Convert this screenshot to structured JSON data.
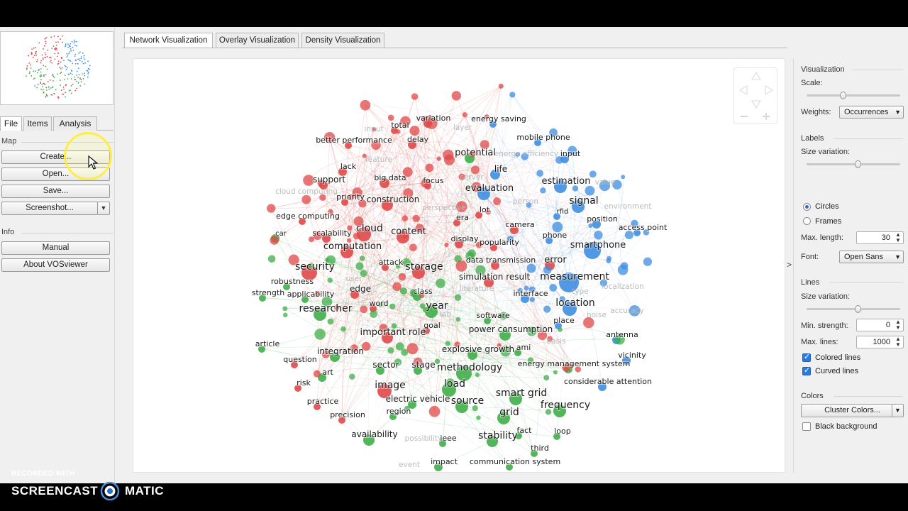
{
  "app": {
    "left_tabs": [
      "File",
      "Items",
      "Analysis"
    ],
    "main_tabs": [
      "Network Visualization",
      "Overlay Visualization",
      "Density Visualization"
    ]
  },
  "left_panel": {
    "map_label": "Map",
    "buttons": {
      "create": "Create...",
      "open": "Open...",
      "save": "Save...",
      "screenshot": "Screenshot..."
    },
    "info_label": "Info",
    "info_buttons": {
      "manual": "Manual",
      "about": "About VOSviewer"
    }
  },
  "right_panel": {
    "visualization_label": "Visualization",
    "scale_label": "Scale:",
    "scale_level": 0.38,
    "weights_label": "Weights:",
    "weights_value": "Occurrences",
    "labels_label": "Labels",
    "size_variation_label": "Size variation:",
    "label_size_variation_level": 0.55,
    "circles_label": "Circles",
    "frames_label": "Frames",
    "max_length_label": "Max. length:",
    "max_length_value": "30",
    "font_label": "Font:",
    "font_value": "Open Sans",
    "lines_label": "Lines",
    "lines_size_variation_label": "Size variation:",
    "line_size_variation_level": 0.55,
    "min_strength_label": "Min. strength:",
    "min_strength_value": "0",
    "max_lines_label": "Max. lines:",
    "max_lines_value": "1000",
    "colored_lines_label": "Colored lines",
    "curved_lines_label": "Curved lines",
    "colors_label": "Colors",
    "cluster_colors_label": "Cluster Colors...",
    "black_background_label": "Black background"
  },
  "network": {
    "cluster_colors": {
      "red": "#e04848",
      "green": "#3fae49",
      "blue": "#3f8ee0"
    },
    "terms": [
      {
        "t": "variation",
        "c": "red"
      },
      {
        "t": "energy saving",
        "c": "blue"
      },
      {
        "t": "total",
        "c": "red"
      },
      {
        "t": "better performance",
        "c": "red"
      },
      {
        "t": "delay",
        "c": "red"
      },
      {
        "t": "mobile phone",
        "c": "blue"
      },
      {
        "t": "potential",
        "c": "green"
      },
      {
        "t": "input",
        "c": "blue"
      },
      {
        "t": "lack",
        "c": "red"
      },
      {
        "t": "life",
        "c": "blue"
      },
      {
        "t": "support",
        "c": "red"
      },
      {
        "t": "big data",
        "c": "red"
      },
      {
        "t": "focus",
        "c": "red"
      },
      {
        "t": "estimation",
        "c": "blue"
      },
      {
        "t": "evaluation",
        "c": "blue"
      },
      {
        "t": "priority",
        "c": "red"
      },
      {
        "t": "construction",
        "c": "red"
      },
      {
        "t": "signal",
        "c": "blue"
      },
      {
        "t": "rfid",
        "c": "blue"
      },
      {
        "t": "lot",
        "c": "red"
      },
      {
        "t": "edge computing",
        "c": "red"
      },
      {
        "t": "era",
        "c": "red"
      },
      {
        "t": "position",
        "c": "blue"
      },
      {
        "t": "camera",
        "c": "red"
      },
      {
        "t": "access point",
        "c": "blue"
      },
      {
        "t": "cloud",
        "c": "red"
      },
      {
        "t": "content",
        "c": "red"
      },
      {
        "t": "car",
        "c": "green"
      },
      {
        "t": "scalability",
        "c": "red"
      },
      {
        "t": "phone",
        "c": "blue"
      },
      {
        "t": "display",
        "c": "red"
      },
      {
        "t": "popularity",
        "c": "red"
      },
      {
        "t": "smartphone",
        "c": "blue"
      },
      {
        "t": "computation",
        "c": "red"
      },
      {
        "t": "error",
        "c": "red"
      },
      {
        "t": "data transmission",
        "c": "red"
      },
      {
        "t": "attack",
        "c": "red"
      },
      {
        "t": "security",
        "c": "red"
      },
      {
        "t": "storage",
        "c": "red"
      },
      {
        "t": "measurement",
        "c": "blue"
      },
      {
        "t": "simulation result",
        "c": "red"
      },
      {
        "t": "robustness",
        "c": "green"
      },
      {
        "t": "edge",
        "c": "red"
      },
      {
        "t": "interface",
        "c": "blue"
      },
      {
        "t": "strength",
        "c": "green"
      },
      {
        "t": "applicability",
        "c": "green"
      },
      {
        "t": "class",
        "c": "green"
      },
      {
        "t": "location",
        "c": "blue"
      },
      {
        "t": "word",
        "c": "red"
      },
      {
        "t": "year",
        "c": "green"
      },
      {
        "t": "researcher",
        "c": "green"
      },
      {
        "t": "software",
        "c": "green"
      },
      {
        "t": "place",
        "c": "blue"
      },
      {
        "t": "goal",
        "c": "red"
      },
      {
        "t": "important role",
        "c": "red"
      },
      {
        "t": "power consumption",
        "c": "green"
      },
      {
        "t": "antenna",
        "c": "blue"
      },
      {
        "t": "article",
        "c": "green"
      },
      {
        "t": "explosive growth",
        "c": "green"
      },
      {
        "t": "ami",
        "c": "green"
      },
      {
        "t": "integration",
        "c": "green"
      },
      {
        "t": "vicinity",
        "c": "blue"
      },
      {
        "t": "question",
        "c": "red"
      },
      {
        "t": "energy management system",
        "c": "green"
      },
      {
        "t": "sector",
        "c": "green"
      },
      {
        "t": "stage",
        "c": "green"
      },
      {
        "t": "methodology",
        "c": "green"
      },
      {
        "t": "art",
        "c": "green"
      },
      {
        "t": "considerable attention",
        "c": "blue"
      },
      {
        "t": "risk",
        "c": "red"
      },
      {
        "t": "image",
        "c": "red"
      },
      {
        "t": "load",
        "c": "green"
      },
      {
        "t": "smart grid",
        "c": "green"
      },
      {
        "t": "electric vehicle",
        "c": "green"
      },
      {
        "t": "practice",
        "c": "red"
      },
      {
        "t": "source",
        "c": "green"
      },
      {
        "t": "frequency",
        "c": "green"
      },
      {
        "t": "region",
        "c": "green"
      },
      {
        "t": "grid",
        "c": "green"
      },
      {
        "t": "precision",
        "c": "red"
      },
      {
        "t": "availability",
        "c": "green"
      },
      {
        "t": "stability",
        "c": "green"
      },
      {
        "t": "fact",
        "c": "green"
      },
      {
        "t": "loop",
        "c": "green"
      },
      {
        "t": "ieee",
        "c": "green"
      },
      {
        "t": "third",
        "c": "green"
      },
      {
        "t": "impact",
        "c": "green"
      },
      {
        "t": "communication system",
        "c": "green"
      }
    ],
    "faded_terms": [
      "input",
      "layer",
      "energy efficiency",
      "server",
      "cloud computing",
      "perspective",
      "person",
      "environment",
      "value",
      "localization",
      "noise",
      "basis",
      "feature",
      "user",
      "possibility",
      "event",
      "lab",
      "accuracy",
      "type",
      "literature"
    ]
  },
  "watermark": {
    "line1": "RECORDED WITH",
    "left": "SCREENCAST",
    "right": "MATIC"
  }
}
